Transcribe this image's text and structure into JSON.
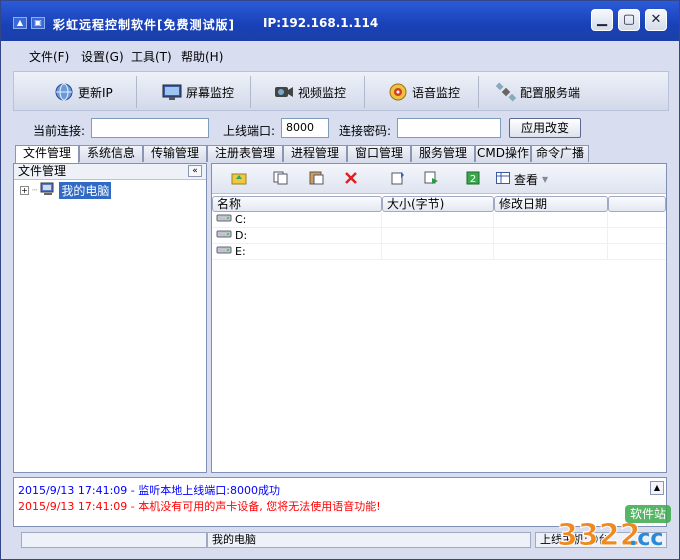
{
  "window": {
    "title": "彩虹远程控制软件[免费测试版]",
    "ip_label": "IP:192.168.1.114",
    "sys_buttons": [
      "▲",
      "▣"
    ],
    "controls": {
      "minimize": "▁",
      "maximize": "▢",
      "close": "✕"
    }
  },
  "menubar": {
    "items": [
      "文件(F)",
      "设置(G)",
      "工具(T)",
      "帮助(H)"
    ]
  },
  "toolbar": {
    "buttons": [
      {
        "label": "更新IP",
        "icon": "globe-icon"
      },
      {
        "label": "屏幕监控",
        "icon": "monitor-icon"
      },
      {
        "label": "视频监控",
        "icon": "camera-icon"
      },
      {
        "label": "语音监控",
        "icon": "audio-icon"
      },
      {
        "label": "配置服务端",
        "icon": "satellite-icon"
      }
    ]
  },
  "connection": {
    "current_label": "当前连接:",
    "current_value": "",
    "port_label": "上线端口:",
    "port_value": "8000",
    "password_label": "连接密码:",
    "password_value": "",
    "apply_label": "应用改变"
  },
  "tabs": [
    "文件管理",
    "系统信息",
    "传输管理",
    "注册表管理",
    "进程管理",
    "窗口管理",
    "服务管理",
    "CMD操作",
    "命令广播"
  ],
  "tree": {
    "header": "文件管理",
    "collapse": "«",
    "expander": "+",
    "items": [
      {
        "label": "我的电脑"
      }
    ]
  },
  "file_toolbar": {
    "view_label": "查看"
  },
  "file_table": {
    "columns": [
      "名称",
      "大小(字节)",
      "修改日期",
      ""
    ],
    "rows": [
      {
        "name": "C:",
        "size": "",
        "modified": ""
      },
      {
        "name": "D:",
        "size": "",
        "modified": ""
      },
      {
        "name": "E:",
        "size": "",
        "modified": ""
      }
    ]
  },
  "log": {
    "lines": [
      {
        "text": "2015/9/13 17:41:09 - 监听本地上线端口:8000成功",
        "color": "#0000ff"
      },
      {
        "text": "2015/9/13 17:41:09 - 本机没有可用的声卡设备, 您将无法使用语音功能!",
        "color": "#ff0000"
      }
    ],
    "scroll": "▲"
  },
  "statusbar": {
    "left": "",
    "middle": "我的电脑",
    "right": "上线主机: 0台"
  },
  "watermark": {
    "big": "3322",
    "suffix": ".cc",
    "small": "软件站"
  },
  "colors": {
    "titlebar": "#1941b8",
    "selection": "#316ac5",
    "log_info": "#0000ff",
    "log_error": "#ff0000"
  }
}
